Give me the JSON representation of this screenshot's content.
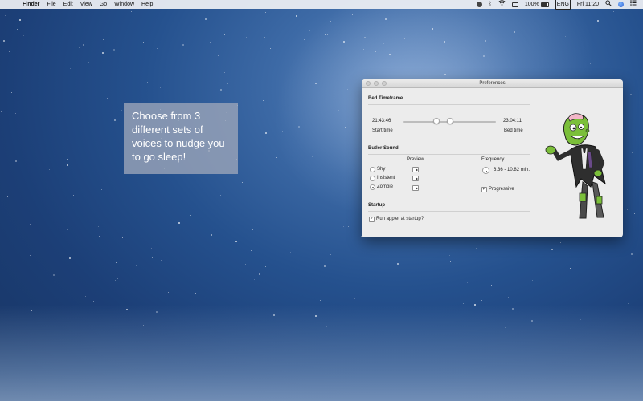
{
  "menubar": {
    "app_name": "Finder",
    "items": [
      "File",
      "Edit",
      "View",
      "Go",
      "Window",
      "Help"
    ],
    "battery": "100%",
    "input_source": "ENG",
    "clock": "Fri 11:20",
    "icons": [
      "apple-icon",
      "app-indicator-icon",
      "bluetooth-icon",
      "wifi-icon",
      "airplay-icon",
      "battery-icon",
      "input-source-icon",
      "spotlight-icon",
      "siri-icon",
      "notification-center-icon"
    ]
  },
  "callout": {
    "text": "Choose from 3 different sets of voices to nudge you to go sleep!"
  },
  "window": {
    "title": "Preferences",
    "bed_timeframe": {
      "heading": "Bed Timeframe",
      "start_value": "21:43:46",
      "end_value": "23:04:11",
      "start_label": "Start time",
      "end_label": "Bed time"
    },
    "butler_sound": {
      "heading": "Butler Sound",
      "preview_header": "Preview",
      "options": [
        {
          "label": "Shy",
          "selected": false
        },
        {
          "label": "Insistent",
          "selected": false
        },
        {
          "label": "Zombie",
          "selected": true
        }
      ],
      "frequency_header": "Frequency",
      "frequency_value": "6.36 - 10.82 min.",
      "progressive_label": "Progressive",
      "progressive_checked": true
    },
    "startup": {
      "heading": "Startup",
      "run_label": "Run applet at startup?",
      "run_checked": true
    }
  },
  "colors": {
    "desktop": "#25518e",
    "window_bg": "#ececec",
    "zombie_skin": "#7bbf3a"
  }
}
